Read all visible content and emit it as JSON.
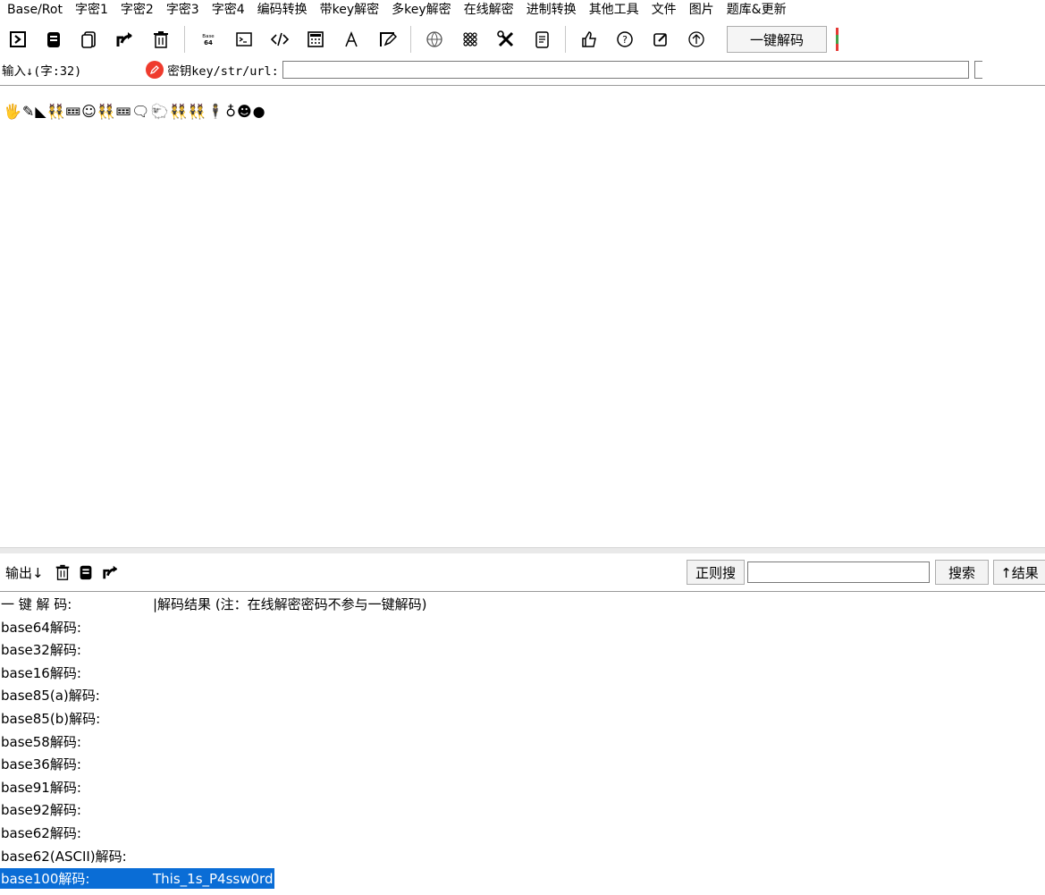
{
  "menu": [
    "Base/Rot",
    "字密1",
    "字密2",
    "字密3",
    "字密4",
    "编码转换",
    "带key解密",
    "多key解密",
    "在线解密",
    "进制转换",
    "其他工具",
    "文件",
    "图片",
    "题库&更新"
  ],
  "toolbar": {
    "icons": [
      "import-icon",
      "copy-icon",
      "paste-icon",
      "share-icon",
      "trash-icon",
      "base64-icon",
      "terminal-icon",
      "code-icon",
      "calculator-icon",
      "font-icon",
      "edit-icon",
      "globe-icon",
      "grid-icon",
      "tools-icon",
      "document-icon",
      "like-icon",
      "help-icon",
      "notes-icon",
      "upload-icon"
    ],
    "base_icon_text": "Base\n64",
    "onekey_label": "一键解码"
  },
  "input": {
    "label": "输入↓(字:32)",
    "key_label": "密钥key/str/url:",
    "key_value": "",
    "emoji_text": "🖐✎◣👯🝚☺👯🝚🗨🐑👯👯🕴♁☻●"
  },
  "output": {
    "label": "输出↓",
    "regex_button": "正则搜",
    "search_value": "",
    "search_button": "搜索",
    "result_button": "↑结果"
  },
  "results": [
    {
      "key": "一 键 解 码:",
      "value": "|解码结果 (注：在线解密密码不参与一键解码)",
      "selected": false
    },
    {
      "key": "base64解码:",
      "value": "",
      "selected": false
    },
    {
      "key": "base32解码:",
      "value": "",
      "selected": false
    },
    {
      "key": "base16解码:",
      "value": "",
      "selected": false
    },
    {
      "key": "base85(a)解码:",
      "value": "",
      "selected": false
    },
    {
      "key": "base85(b)解码:",
      "value": "",
      "selected": false
    },
    {
      "key": "base58解码:",
      "value": "",
      "selected": false
    },
    {
      "key": "base36解码:",
      "value": "",
      "selected": false
    },
    {
      "key": "base91解码:",
      "value": "",
      "selected": false
    },
    {
      "key": "base92解码:",
      "value": "",
      "selected": false
    },
    {
      "key": "base62解码:",
      "value": "",
      "selected": false
    },
    {
      "key": "base62(ASCII)解码:",
      "value": "",
      "selected": false
    },
    {
      "key": "base100解码:",
      "value": "This_1s_P4ssw0rd",
      "selected": true
    }
  ],
  "colors": {
    "selection": "#0a6dd6",
    "key_icon": "#ef3b2d",
    "divider": "#e9e9e9"
  }
}
